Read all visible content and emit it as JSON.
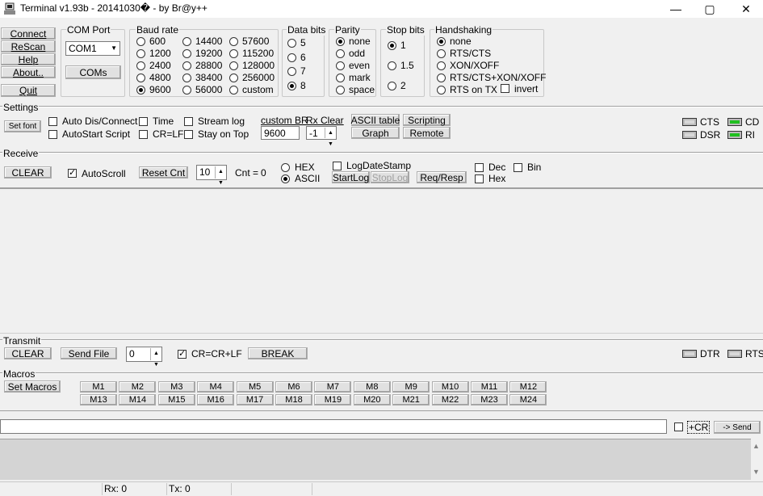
{
  "window": {
    "title": "Terminal v1.93b - 20141030� - by Br@y++",
    "minimize": "—",
    "maximize": "▢",
    "close": "✕"
  },
  "left_buttons": {
    "connect": "Connect",
    "rescan": "ReScan",
    "help": "Help",
    "about": "About..",
    "quit": "Quit"
  },
  "com_port": {
    "label": "COM Port",
    "value": "COM1",
    "coms_button": "COMs"
  },
  "baud_rate": {
    "label": "Baud rate",
    "options": [
      "600",
      "1200",
      "2400",
      "4800",
      "9600",
      "14400",
      "19200",
      "28800",
      "38400",
      "56000",
      "57600",
      "115200",
      "128000",
      "256000",
      "custom"
    ],
    "selected": "9600"
  },
  "data_bits": {
    "label": "Data bits",
    "options": [
      "5",
      "6",
      "7",
      "8"
    ],
    "selected": "8"
  },
  "parity": {
    "label": "Parity",
    "options": [
      "none",
      "odd",
      "even",
      "mark",
      "space"
    ],
    "selected": "none"
  },
  "stop_bits": {
    "label": "Stop bits",
    "options": [
      "1",
      "1.5",
      "2"
    ],
    "selected": "1"
  },
  "handshaking": {
    "label": "Handshaking",
    "options": [
      "none",
      "RTS/CTS",
      "XON/XOFF",
      "RTS/CTS+XON/XOFF",
      "RTS on TX"
    ],
    "selected": "none",
    "invert_label": "invert"
  },
  "settings": {
    "label": "Settings",
    "set_font": "Set font",
    "auto_dis_connect": "Auto Dis/Connect",
    "autostart_script": "AutoStart Script",
    "time": "Time",
    "cr_lf": "CR=LF",
    "stream_log": "Stream log",
    "stay_on_top": "Stay on Top",
    "custom_br_label": "custom BR",
    "custom_br_value": "9600",
    "rx_clear_label": "Rx Clear",
    "rx_clear_value": "-1",
    "ascii_table": "ASCII table",
    "graph": "Graph",
    "scripting": "Scripting",
    "remote": "Remote"
  },
  "signals_top": {
    "cts": "CTS",
    "dsr": "DSR",
    "cd": "CD",
    "ri": "RI"
  },
  "receive": {
    "label": "Receive",
    "clear": "CLEAR",
    "autoscroll": "AutoScroll",
    "reset_cnt": "Reset Cnt",
    "cnt_spin": "10",
    "cnt_label": "Cnt =",
    "cnt_value": "0",
    "hex": "HEX",
    "ascii": "ASCII",
    "log_date_stamp": "LogDateStamp",
    "start_log": "StartLog",
    "stop_log": "StopLog",
    "req_resp": "Req/Resp",
    "dec": "Dec",
    "hex2": "Hex",
    "bin": "Bin"
  },
  "transmit": {
    "label": "Transmit",
    "clear": "CLEAR",
    "send_file": "Send File",
    "spin_value": "0",
    "cr_crlf": "CR=CR+LF",
    "break": "BREAK",
    "dtr": "DTR",
    "rts": "RTS"
  },
  "macros": {
    "label": "Macros",
    "set_macros": "Set Macros",
    "row1": [
      "M1",
      "M2",
      "M3",
      "M4",
      "M5",
      "M6",
      "M7",
      "M8",
      "M9",
      "M10",
      "M11",
      "M12"
    ],
    "row2": [
      "M13",
      "M14",
      "M15",
      "M16",
      "M17",
      "M18",
      "M19",
      "M20",
      "M21",
      "M22",
      "M23",
      "M24"
    ]
  },
  "send": {
    "input_value": "",
    "plus_cr": "+CR",
    "send_button": "-> Send"
  },
  "status": {
    "rx": "Rx: 0",
    "tx": "Tx: 0"
  }
}
